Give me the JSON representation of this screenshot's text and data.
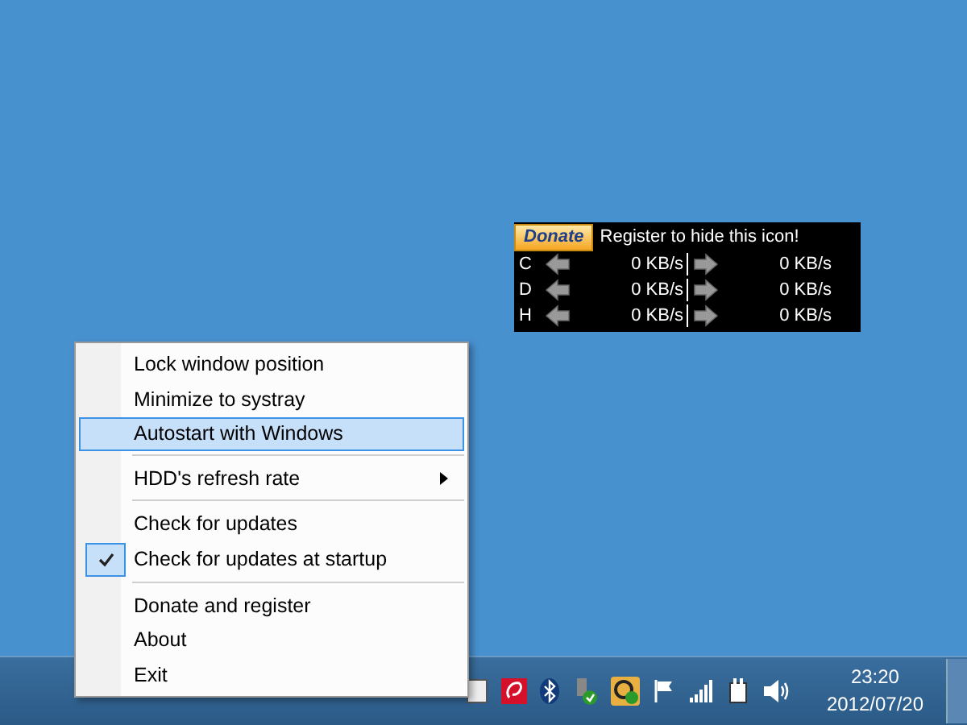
{
  "widget": {
    "donate_button": "Donate",
    "banner": "Register to hide this icon!",
    "drives": [
      {
        "letter": "C",
        "read": "0 KB/s",
        "write": "0 KB/s"
      },
      {
        "letter": "D",
        "read": "0 KB/s",
        "write": "0 KB/s"
      },
      {
        "letter": "H",
        "read": "0 KB/s",
        "write": "0 KB/s"
      }
    ]
  },
  "context_menu": {
    "sections": [
      {
        "items": [
          {
            "label": "Lock window position",
            "selected": false,
            "checked": false,
            "submenu": false
          },
          {
            "label": "Minimize to systray",
            "selected": false,
            "checked": false,
            "submenu": false
          },
          {
            "label": "Autostart with Windows",
            "selected": true,
            "checked": false,
            "submenu": false
          }
        ]
      },
      {
        "items": [
          {
            "label": "HDD's refresh rate",
            "selected": false,
            "checked": false,
            "submenu": true
          }
        ]
      },
      {
        "items": [
          {
            "label": "Check for updates",
            "selected": false,
            "checked": false,
            "submenu": false
          },
          {
            "label": "Check for updates at startup",
            "selected": false,
            "checked": true,
            "submenu": false
          }
        ]
      },
      {
        "items": [
          {
            "label": "Donate and register",
            "selected": false,
            "checked": false,
            "submenu": false
          },
          {
            "label": "About",
            "selected": false,
            "checked": false,
            "submenu": false
          },
          {
            "label": "Exit",
            "selected": false,
            "checked": false,
            "submenu": false
          }
        ]
      }
    ]
  },
  "taskbar": {
    "time": "23:20",
    "date": "2012/07/20"
  }
}
